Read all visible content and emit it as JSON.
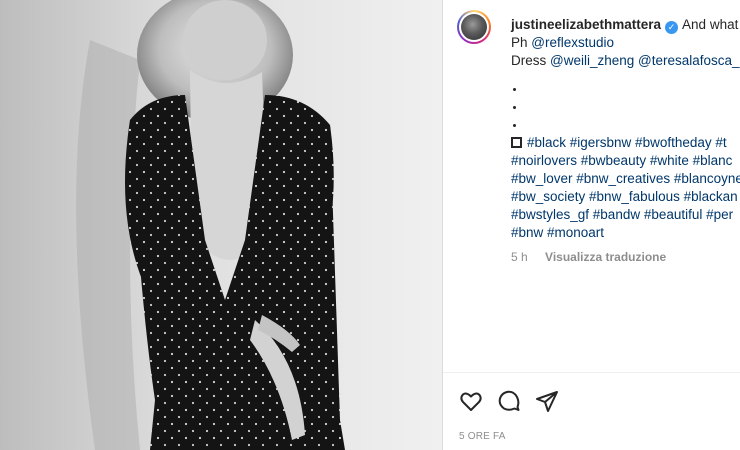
{
  "post": {
    "username": "justineelizabethmattera",
    "caption_start": "And what",
    "photographer_prefix": "Ph",
    "photographer": "@reflexstudio",
    "dress_prefix": "Dress",
    "dress_credit_1": "@weili_zheng",
    "dress_credit_2": "@teresalafosca_p",
    "hashtag_lines": [
      "#black #igersbnw #bwoftheday #t",
      "#noirlovers #bwbeauty #white #blanc",
      "#bw_lover #bnw_creatives #blancoyne",
      "#bw_society #bnw_fabulous #blackan",
      "#bwstyles_gf #bandw #beautiful #per",
      "#bnw #monoart"
    ],
    "time_ago": "5 h",
    "translate_label": "Visualizza traduzione",
    "timestamp": "5 ORE FA"
  },
  "icons": {
    "avatar": "profile-avatar",
    "verified": "verified-badge-icon",
    "like": "heart-icon",
    "comment": "comment-bubble-icon",
    "share": "paper-plane-icon"
  },
  "colors": {
    "link": "#00376b",
    "muted": "#8e8e8e",
    "verified": "#3897f0"
  }
}
